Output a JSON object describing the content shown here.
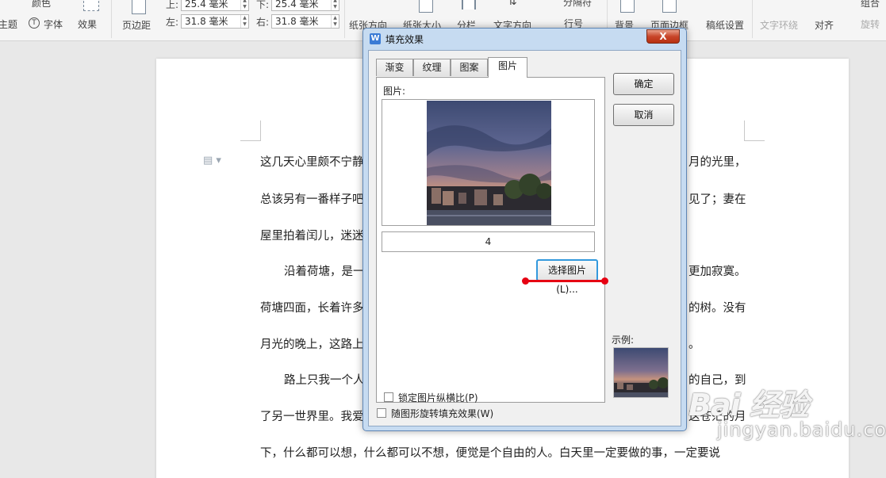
{
  "ribbon": {
    "theme_label": "主题",
    "color_label": "颜色",
    "font_label": "字体",
    "effect_label": "效果",
    "margin_label": "页边距",
    "top_label": "上:",
    "top_value": "25.4 毫米",
    "bottom_label": "下:",
    "bottom_value": "25.4 毫米",
    "left_label": "左:",
    "left_value": "31.8 毫米",
    "right_label": "右:",
    "right_value": "31.8 毫米",
    "orientation_label": "纸张方向",
    "size_label": "纸张大小",
    "columns_label": "分栏",
    "text_dir_label": "文字方向",
    "separator_label": "分隔符",
    "line_num_label": "行号",
    "background_label": "背景",
    "border_label": "页面边框",
    "grid_label": "稿纸设置",
    "wrap_label": "文字环绕",
    "align_label": "对齐",
    "rotate_label": "旋转",
    "group_label": "组合"
  },
  "document": {
    "lines": [
      "这几天心里颇不宁静",
      "月的光里，",
      "总该另有一番样子吧",
      "见了；妻在",
      "屋里拍着闰儿，迷迷",
      "沿着荷塘，是一",
      "更加寂寞。",
      "荷塘四面，长着许多",
      "的树。没有",
      "月光的晚上，这路上",
      "。",
      "路上只我一个人",
      "的自己，到",
      "了另一世界里。我爱",
      "这苍茫的月",
      "下，什么都可以想，什么都可以不想，便觉是个自由的人。白天里一定要做的事，一定要说"
    ]
  },
  "dialog": {
    "title": "填充效果",
    "close_label": "X",
    "tabs": [
      "渐变",
      "纹理",
      "图案",
      "图片"
    ],
    "active_tab": 3,
    "picture_label": "图片:",
    "picture_name": "4",
    "select_button": "选择图片(L)...",
    "lock_ratio_label": "锁定图片纵横比(P)",
    "rotate_fill_label": "随图形旋转填充效果(W)",
    "ok_button": "确定",
    "cancel_button": "取消",
    "sample_label": "示例:"
  },
  "watermark": {
    "main": "Bai 经验",
    "sub": "jingyan.baidu.com"
  },
  "colors": {
    "highlight_red": "#e60012",
    "dialog_frame": "#c6dbf1",
    "focus_blue": "#3399dd"
  }
}
